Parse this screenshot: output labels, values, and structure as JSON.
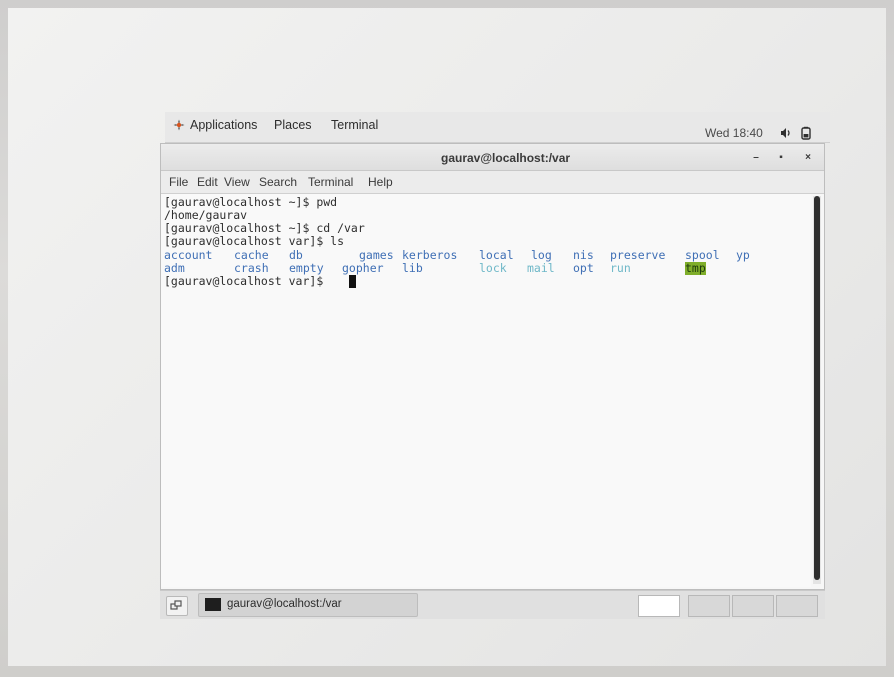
{
  "top_panel": {
    "menus": [
      "Applications",
      "Places",
      "Terminal"
    ],
    "clock": "Wed 18:40",
    "icons": [
      "applications-icon",
      "volume-icon",
      "battery-icon"
    ]
  },
  "window": {
    "title": "gaurav@localhost:/var",
    "controls": {
      "minimize": "–",
      "maximize": "▪",
      "close": "×"
    },
    "menu": [
      "File",
      "Edit",
      "View",
      "Search",
      "Terminal",
      "Help"
    ]
  },
  "terminal": {
    "lines": [
      "[gaurav@localhost ~]$ pwd",
      "/home/gaurav",
      "[gaurav@localhost ~]$ cd /var",
      "[gaurav@localhost var]$ ls"
    ],
    "ls_row1": [
      {
        "name": "account",
        "kind": "dir"
      },
      {
        "name": "cache",
        "kind": "dir"
      },
      {
        "name": "db",
        "kind": "dir"
      },
      {
        "name": "games",
        "kind": "dir"
      },
      {
        "name": "kerberos",
        "kind": "dir"
      },
      {
        "name": "local",
        "kind": "dir"
      },
      {
        "name": "log",
        "kind": "dir"
      },
      {
        "name": "nis",
        "kind": "dir"
      },
      {
        "name": "preserve",
        "kind": "dir"
      },
      {
        "name": "spool",
        "kind": "dir"
      },
      {
        "name": "yp",
        "kind": "dir"
      }
    ],
    "ls_row2": [
      {
        "name": "adm",
        "kind": "dir"
      },
      {
        "name": "crash",
        "kind": "dir"
      },
      {
        "name": "empty",
        "kind": "dir"
      },
      {
        "name": "gopher",
        "kind": "dir"
      },
      {
        "name": "lib",
        "kind": "dir"
      },
      {
        "name": "lock",
        "kind": "link"
      },
      {
        "name": "mail",
        "kind": "link"
      },
      {
        "name": "opt",
        "kind": "dir"
      },
      {
        "name": "run",
        "kind": "link"
      },
      {
        "name": "tmp",
        "kind": "sticky"
      }
    ],
    "prompt": "[gaurav@localhost var]$ "
  },
  "taskbar": {
    "task_label": "gaurav@localhost:/var"
  },
  "colors": {
    "dir": "#3f6fb5",
    "link": "#6fb8c8",
    "sticky_bg": "#7fae2a"
  }
}
